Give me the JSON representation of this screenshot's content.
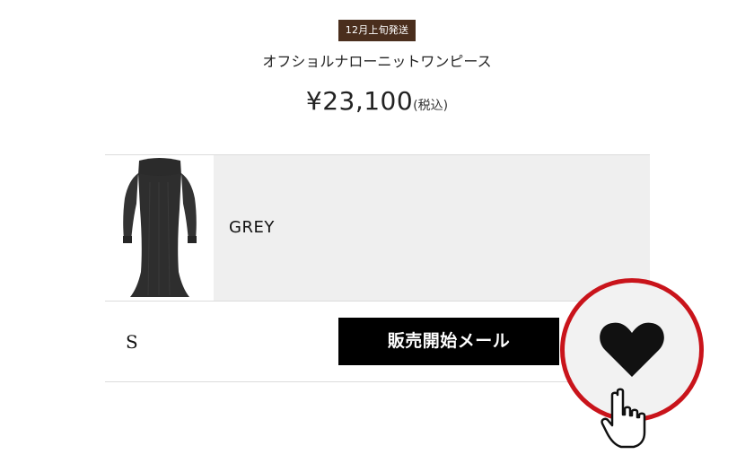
{
  "product": {
    "ship_badge": "12月上旬発送",
    "name": "オフショルナローニットワンピース",
    "price": "¥23,100",
    "tax_note": "(税込)"
  },
  "variant": {
    "color": "GREY",
    "size": "S"
  },
  "actions": {
    "notify_button": "販売開始メール"
  },
  "icons": {
    "favorite": "heart-icon",
    "cursor": "hand-pointer-icon"
  },
  "colors": {
    "badge_bg": "#4a2e1d",
    "button_bg": "#000000",
    "highlight_ring": "#c9141b",
    "color_cell_bg": "#efefef"
  }
}
